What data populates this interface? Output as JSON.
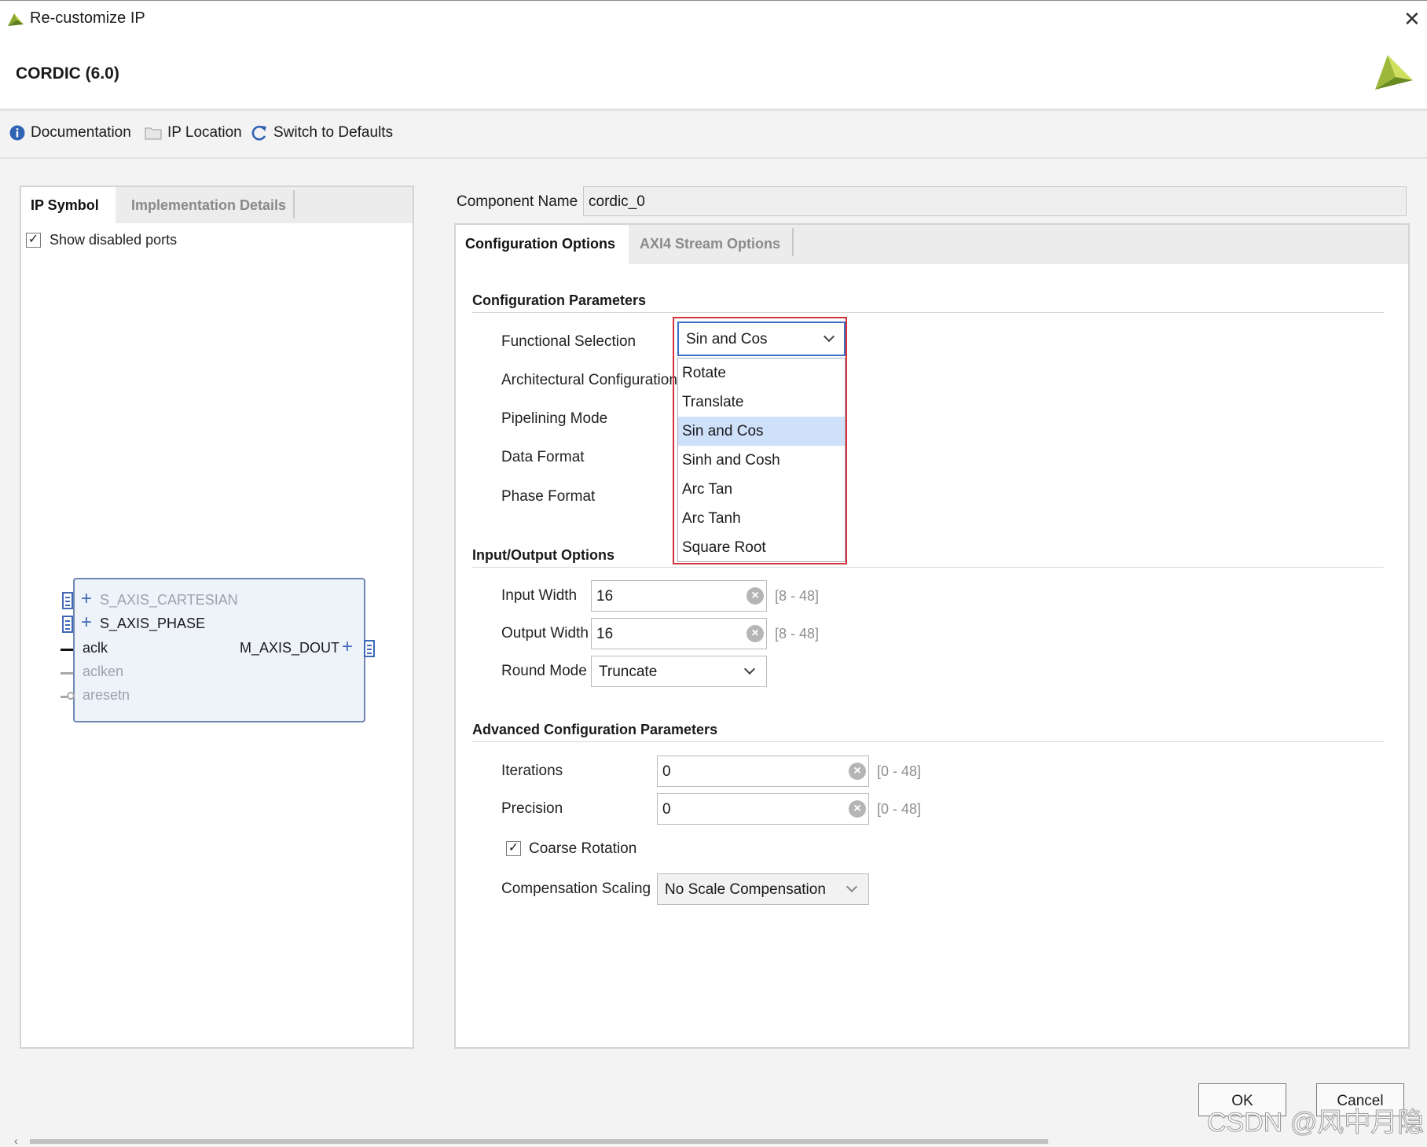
{
  "window": {
    "title": "Re-customize IP",
    "close_glyph": "✕"
  },
  "header": {
    "ip_name": "CORDIC (6.0)"
  },
  "toolbar": {
    "documentation": "Documentation",
    "ip_location": "IP Location",
    "switch_defaults": "Switch to Defaults"
  },
  "left": {
    "tabs": [
      "IP Symbol",
      "Implementation Details"
    ],
    "show_disabled_ports": "Show disabled ports",
    "ports": {
      "s_axis_cartesian": "S_AXIS_CARTESIAN",
      "s_axis_phase": "S_AXIS_PHASE",
      "aclk": "aclk",
      "aclken": "aclken",
      "aresetn": "aresetn",
      "m_axis_dout": "M_AXIS_DOUT"
    }
  },
  "component": {
    "label": "Component Name",
    "value": "cordic_0"
  },
  "right": {
    "tabs": [
      "Configuration Options",
      "AXI4 Stream Options"
    ],
    "config_params": {
      "title": "Configuration Parameters",
      "functional_selection": "Functional Selection",
      "architectural_configuration": "Architectural Configuration",
      "pipelining_mode": "Pipelining Mode",
      "data_format": "Data Format",
      "phase_format": "Phase Format"
    },
    "dropdown": {
      "selected": "Sin and Cos",
      "options": [
        "Rotate",
        "Translate",
        "Sin and Cos",
        "Sinh and Cosh",
        "Arc Tan",
        "Arc Tanh",
        "Square Root"
      ]
    },
    "io_options": {
      "title": "Input/Output Options",
      "input_width_label": "Input Width",
      "input_width": "16",
      "input_width_range": "[8 - 48]",
      "output_width_label": "Output Width",
      "output_width": "16",
      "output_width_range": "[8 - 48]",
      "round_mode_label": "Round Mode",
      "round_mode": "Truncate"
    },
    "advanced": {
      "title": "Advanced Configuration Parameters",
      "iterations_label": "Iterations",
      "iterations": "0",
      "iterations_range": "[0 - 48]",
      "precision_label": "Precision",
      "precision": "0",
      "precision_range": "[0 - 48]",
      "coarse_rotation": "Coarse Rotation",
      "compensation_label": "Compensation Scaling",
      "compensation": "No Scale Compensation"
    }
  },
  "buttons": {
    "ok": "OK",
    "cancel": "Cancel"
  },
  "watermark": "CSDN @风中月隐",
  "colors": {
    "accent_blue": "#3b6fc4",
    "highlight": "#d4323a",
    "selected_option": "#cfe0fb"
  }
}
